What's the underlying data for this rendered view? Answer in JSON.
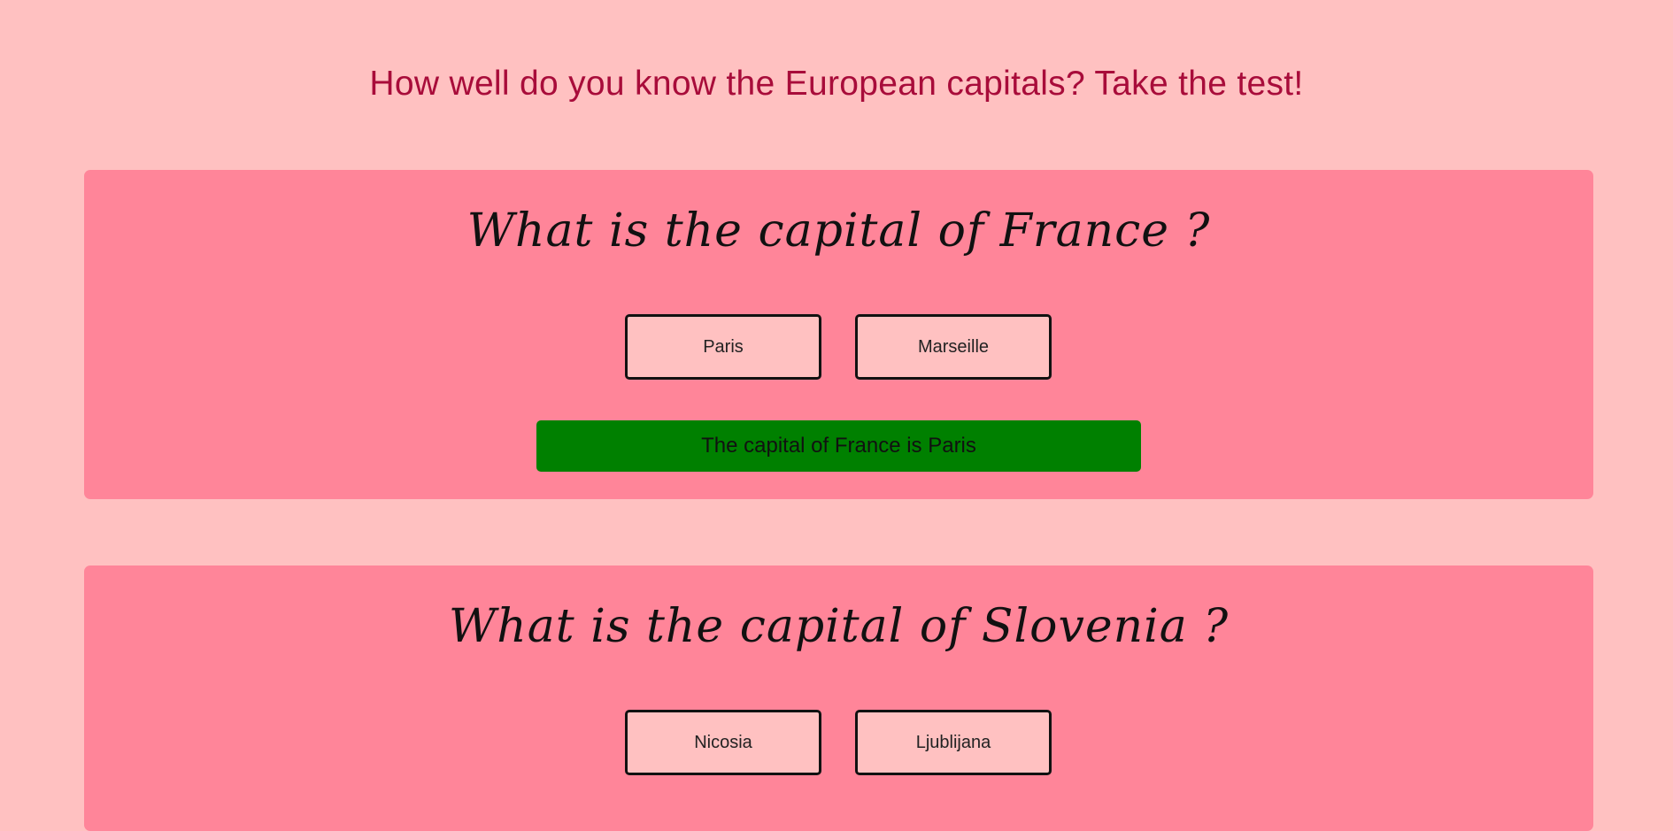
{
  "page": {
    "title": "How well do you know the European capitals? Take the test!"
  },
  "colors": {
    "background": "#ffc1c1",
    "title": "#a80c3a",
    "card": "#ff8599",
    "answer_button": "#ffc1c1",
    "feedback_correct": "#008000"
  },
  "questions": [
    {
      "question": "What is the capital of France ?",
      "answers": [
        "Paris",
        "Marseille"
      ],
      "feedback": "The capital of France is Paris"
    },
    {
      "question": "What is the capital of Slovenia ?",
      "answers": [
        "Nicosia",
        "Ljublijana"
      ]
    }
  ]
}
